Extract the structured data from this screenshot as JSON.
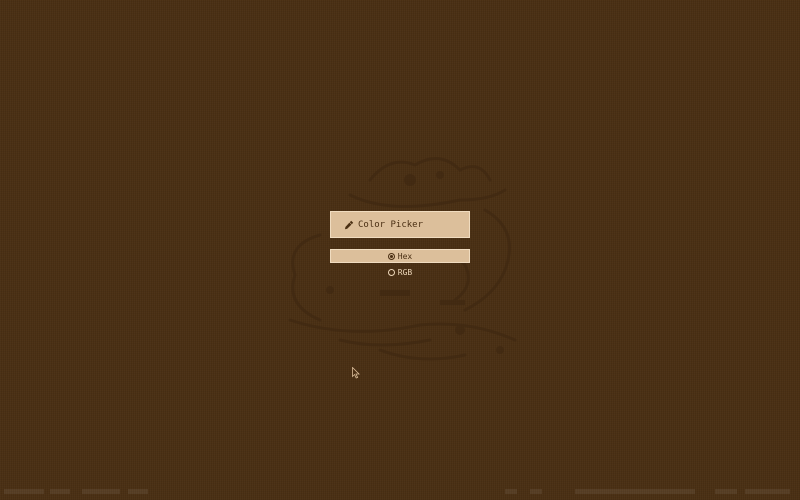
{
  "picker": {
    "label": "Color Picker",
    "icon": "eyedropper-icon"
  },
  "formats": {
    "selected": "Hex",
    "options": [
      {
        "label": "Hex",
        "checked": true
      },
      {
        "label": "RGB",
        "checked": false
      }
    ]
  },
  "colors": {
    "background": "#4a2f13",
    "button_fill": "#dcbf9b",
    "button_text": "#4a2f13",
    "option_text": "#ecd6b8"
  }
}
